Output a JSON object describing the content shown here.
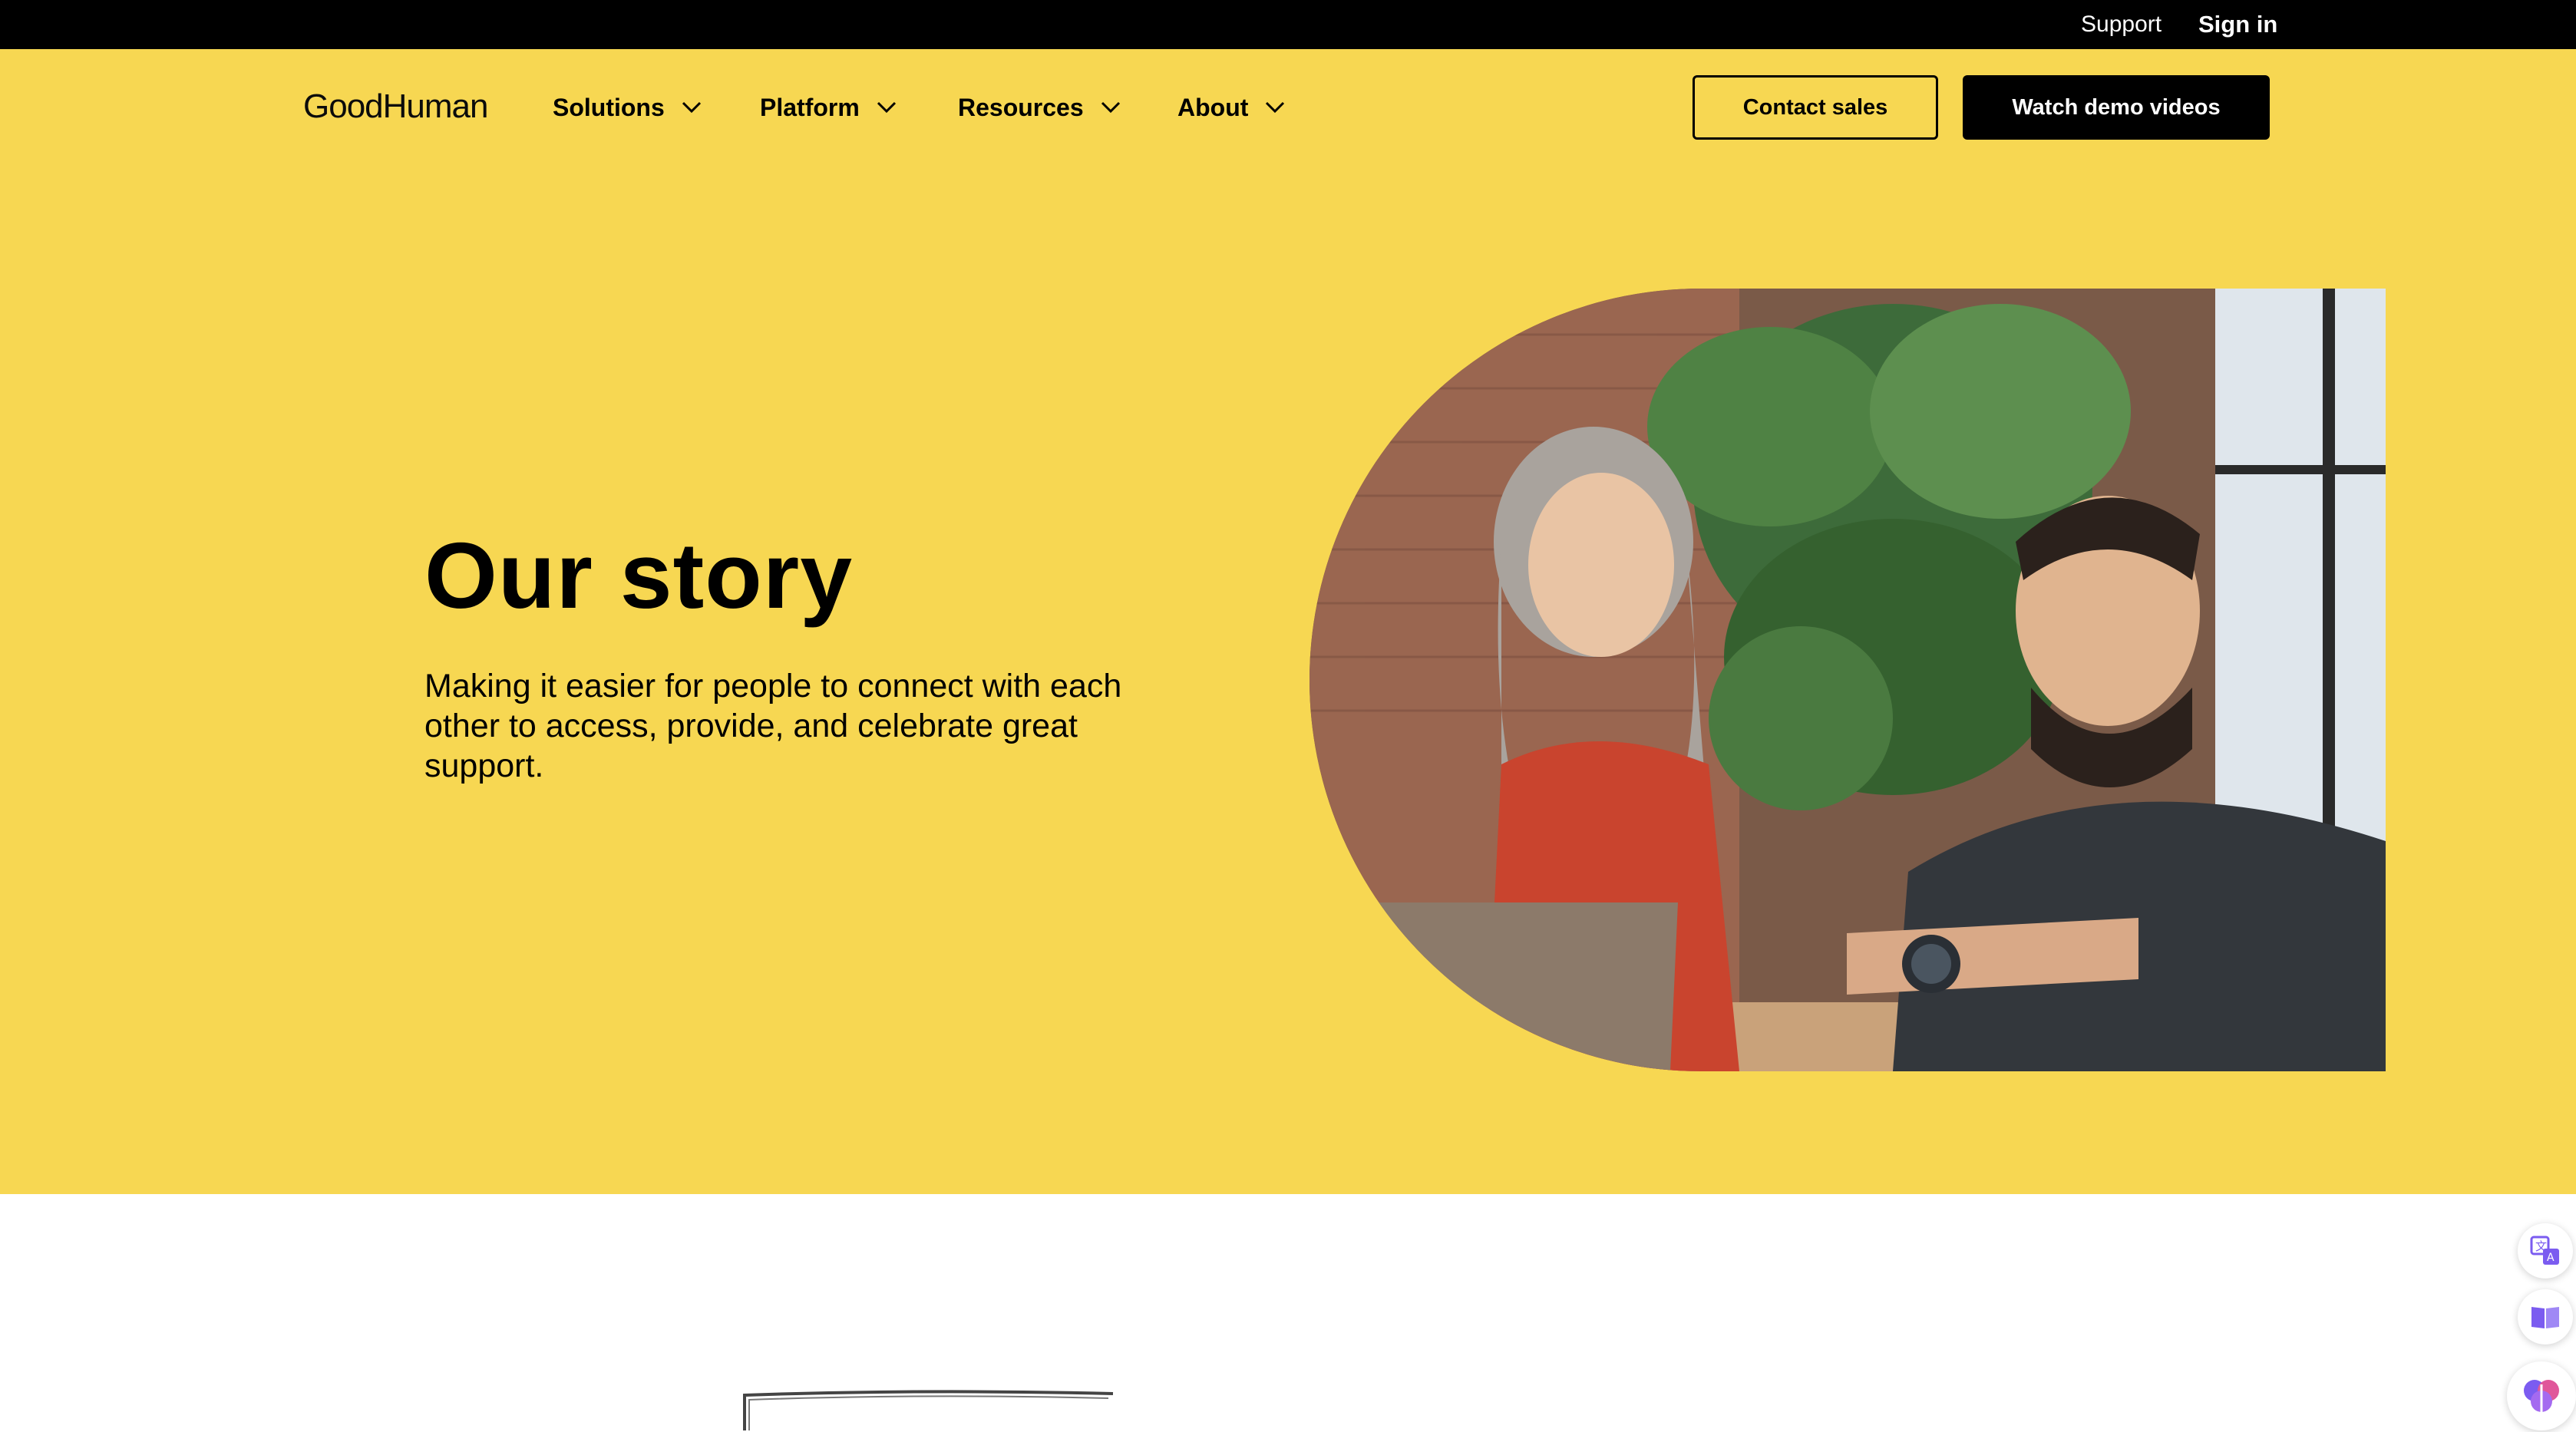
{
  "utility_bar": {
    "support_label": "Support",
    "sign_in_label": "Sign in"
  },
  "header": {
    "logo_text": "GoodHuman",
    "nav": [
      {
        "label": "Solutions"
      },
      {
        "label": "Platform"
      },
      {
        "label": "Resources"
      },
      {
        "label": "About"
      }
    ],
    "contact_sales_label": "Contact sales",
    "watch_demo_label": "Watch demo videos"
  },
  "hero": {
    "title": "Our story",
    "subtitle": "Making it easier for people to connect with each other to access, provide, and celebrate great support.",
    "image_icon": "people-at-laptop-photo"
  },
  "floating_tools": [
    {
      "icon": "translate-icon"
    },
    {
      "icon": "book-reader-icon"
    },
    {
      "icon": "brain-ai-icon"
    }
  ],
  "colors": {
    "hero_background": "#f7d752",
    "utility_bar": "#000000",
    "primary_button": "#000000",
    "accent_tools": "#7b5cf0"
  }
}
